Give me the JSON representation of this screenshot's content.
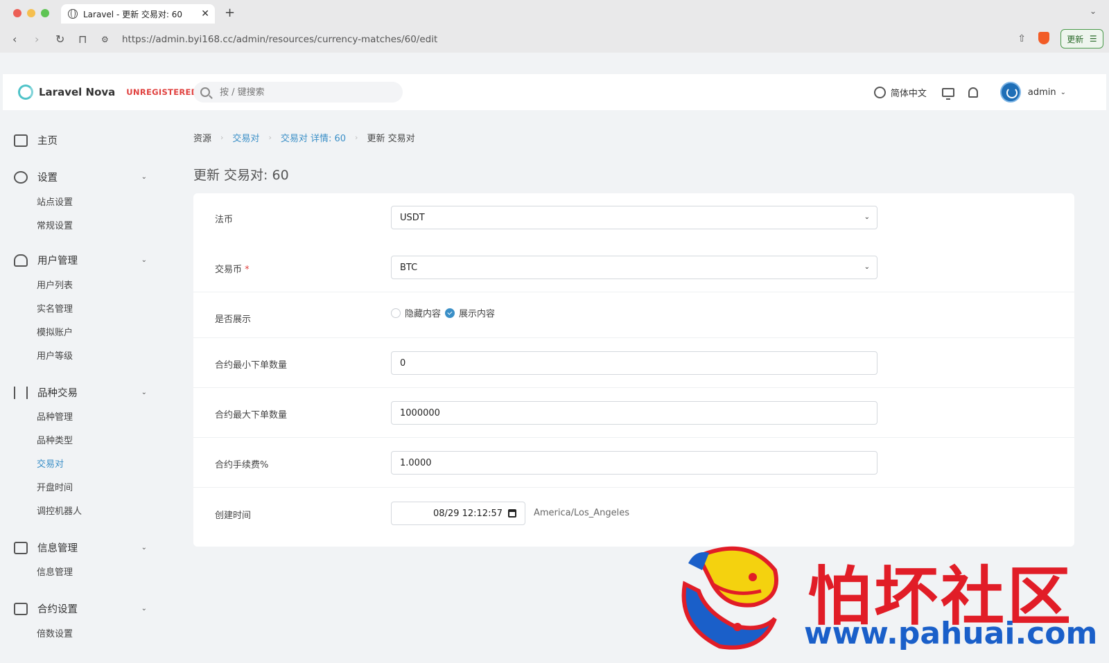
{
  "browser": {
    "tab_title": "Laravel - 更新 交易对: 60",
    "tab_close": "✕",
    "new_tab": "+",
    "tab_dropdown": "⌄",
    "url_host": "https://admin.byi168.cc",
    "url_path": "/admin/resources/currency-matches/60/edit",
    "update_label": "更新",
    "menu_glyph": "☰",
    "back": "‹",
    "forward": "›",
    "reload": "↻",
    "bookmark": "⊓",
    "share": "⇧"
  },
  "header": {
    "brand": "Laravel Nova",
    "unregistered": "UNREGISTERED",
    "search_placeholder": "按 / 键搜索",
    "language": "简体中文",
    "user": "admin",
    "caret": "⌄"
  },
  "sidebar": {
    "home": "主页",
    "chev": "⌄",
    "groups": [
      {
        "label": "设置",
        "items": [
          "站点设置",
          "常规设置"
        ]
      },
      {
        "label": "用户管理",
        "items": [
          "用户列表",
          "实名管理",
          "模拟账户",
          "用户等级"
        ]
      },
      {
        "label": "品种交易",
        "items": [
          "品种管理",
          "品种类型",
          "交易对",
          "开盘时间",
          "调控机器人"
        ]
      },
      {
        "label": "信息管理",
        "items": [
          "信息管理"
        ]
      },
      {
        "label": "合约设置",
        "items": [
          "倍数设置"
        ]
      }
    ],
    "active_item": "交易对"
  },
  "breadcrumb": {
    "items": [
      "资源",
      "交易对",
      "交易对 详情: 60",
      "更新 交易对"
    ],
    "sep": "›"
  },
  "page_title": "更新 交易对: 60",
  "form": {
    "fiat_label": "法币",
    "fiat_value": "USDT",
    "coin_label": "交易币",
    "coin_required": "*",
    "coin_value": "BTC",
    "show_label": "是否展示",
    "show_options": [
      "隐藏内容",
      "展示内容"
    ],
    "show_selected": "展示内容",
    "min_label": "合约最小下单数量",
    "min_value": "0",
    "max_label": "合约最大下单数量",
    "max_value": "1000000",
    "fee_label": "合约手续费%",
    "fee_value": "1.0000",
    "created_label": "创建时间",
    "created_value": "08/29 12:12:57",
    "timezone": "America/Los_Angeles",
    "select_chev": "⌄"
  },
  "watermark": {
    "cn": "怕坏社区",
    "url": "www.pahuai.com"
  },
  "colors": {
    "accent": "#3a8fc7",
    "danger": "#e0413f",
    "watermark_red": "#e11d27",
    "watermark_blue": "#1a5fc9"
  }
}
